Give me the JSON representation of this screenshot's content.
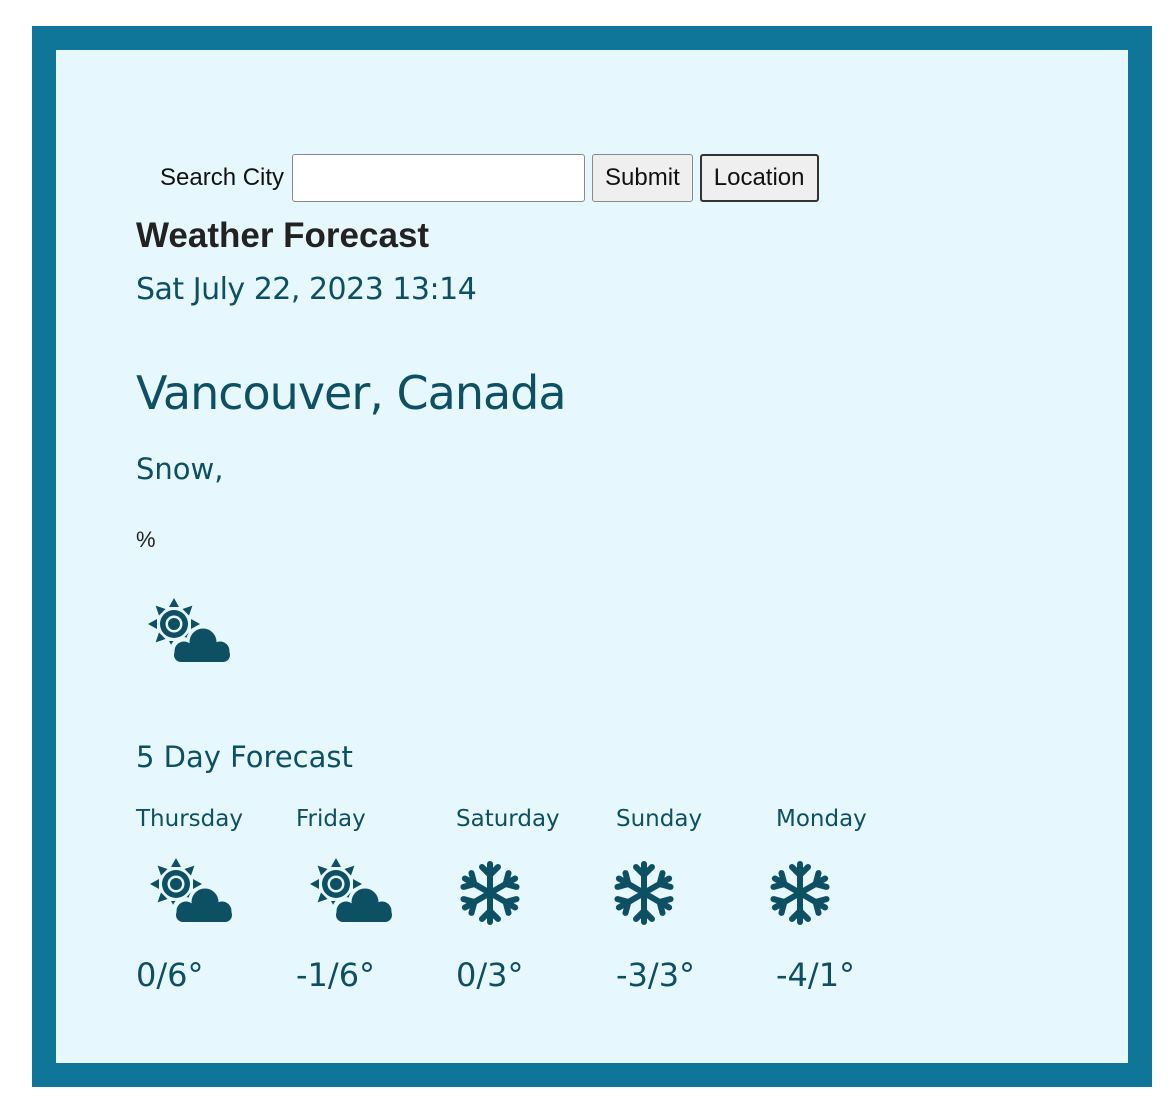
{
  "search": {
    "label": "Search City",
    "value": "",
    "placeholder": "",
    "submit_label": "Submit",
    "location_label": "Location"
  },
  "header": {
    "title": "Weather Forecast",
    "datetime": "Sat July 22, 2023 13:14"
  },
  "current": {
    "city": "Vancouver, Canada",
    "condition": "Snow,",
    "humidity": "%",
    "icon": "sun-cloud-icon"
  },
  "forecast": {
    "heading": "5 Day Forecast",
    "days": [
      {
        "name": "Thursday",
        "temp": "0/6°",
        "icon": "sun-cloud-icon"
      },
      {
        "name": "Friday",
        "temp": "-1/6°",
        "icon": "sun-cloud-icon"
      },
      {
        "name": "Saturday",
        "temp": "0/3°",
        "icon": "snowflake-icon"
      },
      {
        "name": "Sunday",
        "temp": "-3/3°",
        "icon": "snowflake-icon"
      },
      {
        "name": "Monday",
        "temp": "-4/1°",
        "icon": "snowflake-icon"
      }
    ]
  },
  "colors": {
    "frame_border": "#107699",
    "background": "#e6f7fd",
    "text_accent": "#0d4f63"
  }
}
